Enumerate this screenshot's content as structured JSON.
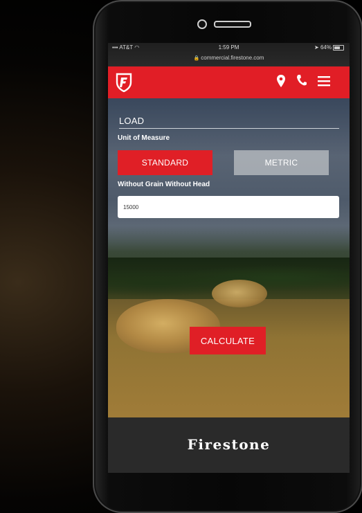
{
  "status_bar": {
    "carrier": "AT&T",
    "time": "1:59 PM",
    "battery": "64%",
    "url": "commercial.firestone.com"
  },
  "nav": {
    "logo_icon": "firestone-f-logo",
    "location_icon": "map-pin-icon",
    "phone_icon": "phone-icon",
    "menu_icon": "hamburger-menu-icon"
  },
  "form": {
    "section_title": "LOAD",
    "unit_label": "Unit of Measure",
    "standard_label": "STANDARD",
    "metric_label": "METRIC",
    "field_label": "Without Grain Without Head",
    "field_value": "15000",
    "calculate_label": "CALCULATE"
  },
  "footer": {
    "brand": "Firestone"
  },
  "colors": {
    "brand_red": "#e11e26",
    "inactive_toggle": "#bec2c6",
    "footer_bg": "#2a2a2a"
  }
}
